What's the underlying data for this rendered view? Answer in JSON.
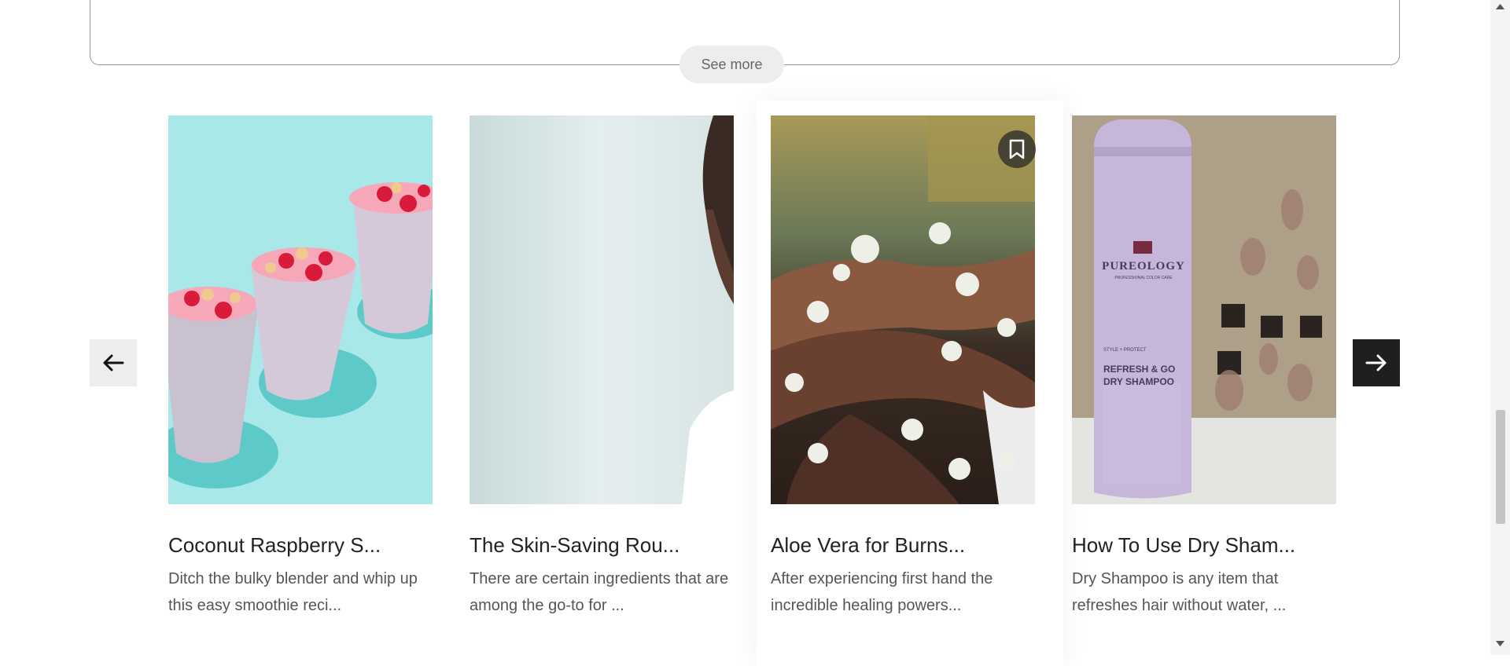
{
  "see_more_label": "See more",
  "cards": [
    {
      "title": "Coconut Raspberry S...",
      "description": "Ditch the bulky blender and whip up this easy smoothie reci..."
    },
    {
      "title": "The Skin-Saving Rou...",
      "description": "There are certain ingredients that are among the go-to for ..."
    },
    {
      "title": "Aloe Vera for Burns...",
      "description": "After experiencing first hand the incredible healing powers..."
    },
    {
      "title": "How To Use Dry Sham...",
      "description": "Dry Shampoo is any item that refreshes hair without water, ..."
    }
  ],
  "product_label": {
    "brand": "PUREOLOGY",
    "tagline": "PROFESSIONAL COLOR CARE",
    "series": "STYLE + PROTECT",
    "name_line1": "REFRESH & GO",
    "name_line2": "DRY SHAMPOO"
  },
  "icons": {
    "prev": "arrow-left-icon",
    "next": "arrow-right-icon",
    "bookmark": "bookmark-icon"
  },
  "colors": {
    "next_button": "#1f1f1f",
    "prev_button": "#ededed",
    "smoothie_bg": "#a8e8e8"
  }
}
